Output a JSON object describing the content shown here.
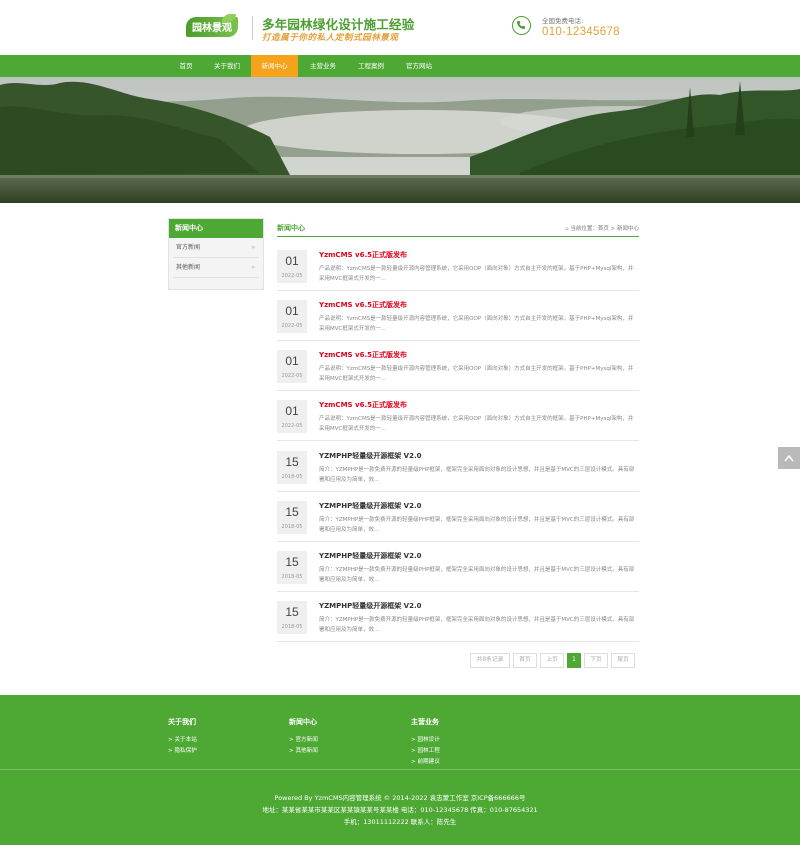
{
  "header": {
    "logo_text": "园林景观",
    "slogan_main": "多年园林绿化设计施工经验",
    "slogan_sub": "打造属于你的私人定制式园林景观",
    "phone_label": "全国免费电话:",
    "phone_number": "010-12345678"
  },
  "nav": {
    "items": [
      {
        "label": "首页"
      },
      {
        "label": "关于我们"
      },
      {
        "label": "新闻中心"
      },
      {
        "label": "主营业务"
      },
      {
        "label": "工程案例"
      },
      {
        "label": "官方网站"
      }
    ],
    "active_index": 2,
    "colors": {
      "bar": "#4ea834",
      "active": "#f5a31b"
    }
  },
  "sidebar": {
    "title": "新闻中心",
    "items": [
      {
        "label": "官方新闻",
        "marker": "»"
      },
      {
        "label": "其他新闻",
        "marker": "»"
      }
    ]
  },
  "content": {
    "title": "新闻中心",
    "breadcrumb": "当前位置：首页 > 新闻中心",
    "list": [
      {
        "day": "01",
        "ym": "2022-05",
        "title": "YzmCMS v6.5正式版发布",
        "style": "red",
        "desc": "产品说明：YzmCMS是一款轻量级开源内容管理系统，它采用OOP（面向对象）方式自主开发的框架。基于PHP+Mysql架构，并采用MVC框架式开发的一..."
      },
      {
        "day": "01",
        "ym": "2022-05",
        "title": "YzmCMS v6.5正式版发布",
        "style": "red",
        "desc": "产品说明：YzmCMS是一款轻量级开源内容管理系统，它采用OOP（面向对象）方式自主开发的框架。基于PHP+Mysql架构，并采用MVC框架式开发的一..."
      },
      {
        "day": "01",
        "ym": "2022-05",
        "title": "YzmCMS v6.5正式版发布",
        "style": "red",
        "desc": "产品说明：YzmCMS是一款轻量级开源内容管理系统，它采用OOP（面向对象）方式自主开发的框架。基于PHP+Mysql架构，并采用MVC框架式开发的一..."
      },
      {
        "day": "01",
        "ym": "2022-05",
        "title": "YzmCMS v6.5正式版发布",
        "style": "red",
        "desc": "产品说明：YzmCMS是一款轻量级开源内容管理系统，它采用OOP（面向对象）方式自主开发的框架。基于PHP+Mysql架构，并采用MVC框架式开发的一..."
      },
      {
        "day": "15",
        "ym": "2018-05",
        "title": "YZMPHP轻量级开源框架 V2.0",
        "style": "dark",
        "desc": "简介：YZMPHP是一款免费开源的轻量级PHP框架，框架完全采用面向对象的设计思想，并且是基于MVC的三层设计模式。具有部署和应用及为简单，效..."
      },
      {
        "day": "15",
        "ym": "2018-05",
        "title": "YZMPHP轻量级开源框架 V2.0",
        "style": "dark",
        "desc": "简介：YZMPHP是一款免费开源的轻量级PHP框架，框架完全采用面向对象的设计思想，并且是基于MVC的三层设计模式。具有部署和应用及为简单，效..."
      },
      {
        "day": "15",
        "ym": "2018-05",
        "title": "YZMPHP轻量级开源框架 V2.0",
        "style": "dark",
        "desc": "简介：YZMPHP是一款免费开源的轻量级PHP框架，框架完全采用面向对象的设计思想，并且是基于MVC的三层设计模式。具有部署和应用及为简单，效..."
      },
      {
        "day": "15",
        "ym": "2018-05",
        "title": "YZMPHP轻量级开源框架 V2.0",
        "style": "dark",
        "desc": "简介：YZMPHP是一款免费开源的轻量级PHP框架，框架完全采用面向对象的设计思想，并且是基于MVC的三层设计模式。具有部署和应用及为简单，效..."
      }
    ]
  },
  "pager": {
    "total": "共8条记录",
    "first": "首页",
    "prev": "上页",
    "current": "1",
    "next": "下页",
    "last": "尾页"
  },
  "footer": {
    "cols": [
      {
        "title": "关于我们",
        "links": [
          "> 关于本站",
          "> 隐私保护"
        ]
      },
      {
        "title": "新闻中心",
        "links": [
          "> 官方新闻",
          "> 其他新闻"
        ]
      },
      {
        "title": "主营业务",
        "links": [
          "> 园林设计",
          "> 园林工程",
          "> 前期建议"
        ]
      }
    ],
    "copyright": "Powered By YzmCMS内容管理系统 © 2014-2022 袁志蒙工作室    京ICP备666666号",
    "address": "地址：某某省某某市某某区某某镇某某号某某楼  电话：010-12345678   传真：010-87654321",
    "mobile": "手机：13011112222   联系人：陈先生"
  }
}
